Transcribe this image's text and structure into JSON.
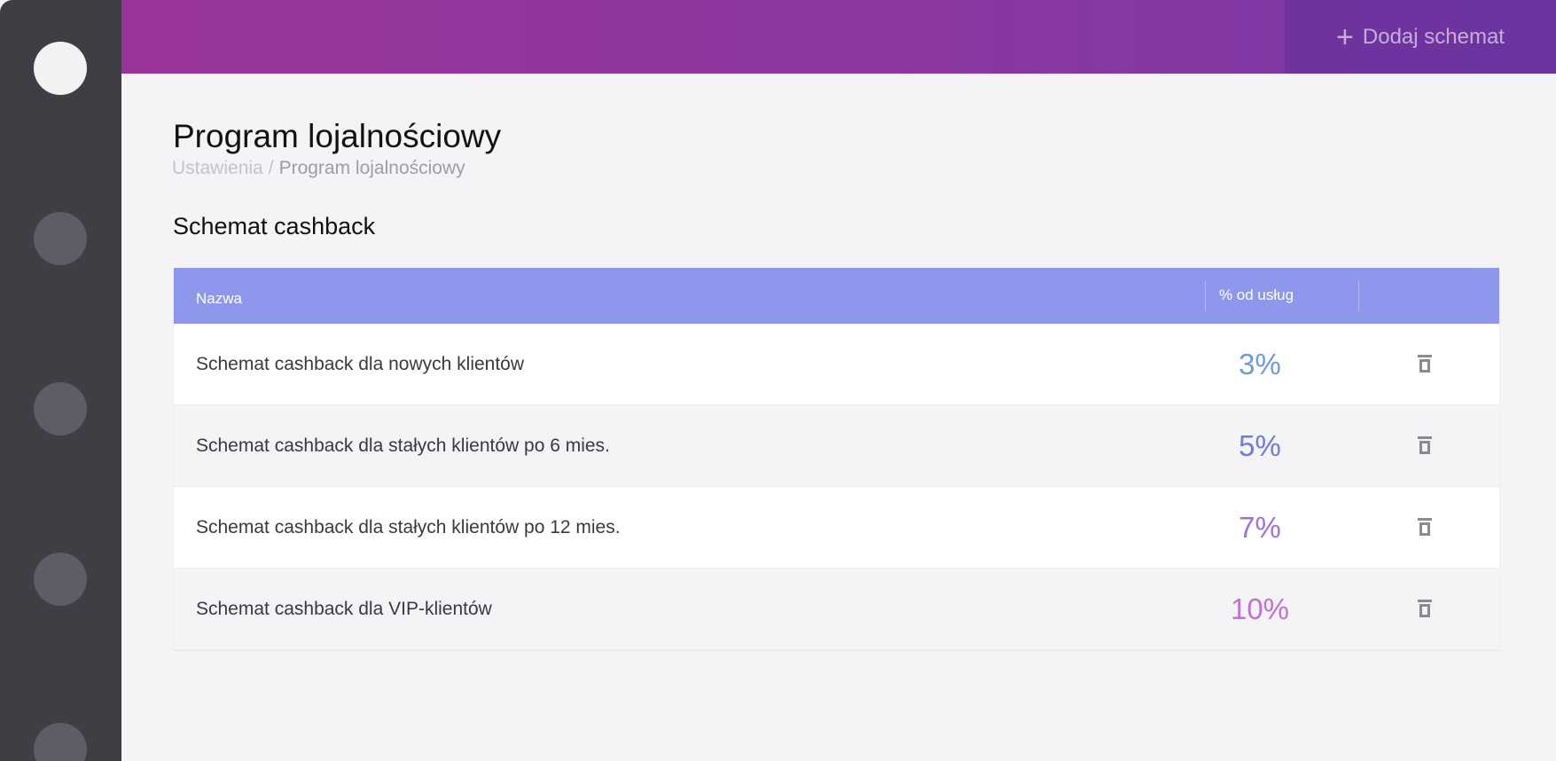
{
  "topbar": {
    "add_button_label": "Dodaj schemat"
  },
  "page": {
    "title": "Program lojalnościowy",
    "breadcrumb": {
      "parent": "Ustawienia",
      "separator": "/",
      "current": "Program lojalnościowy"
    }
  },
  "section": {
    "title": "Schemat cashback"
  },
  "table": {
    "headers": {
      "name": "Nazwa",
      "percent": "% od usług"
    },
    "rows": [
      {
        "name": "Schemat cashback dla nowych klientów",
        "percent": "3%",
        "color": "#6a9ae0"
      },
      {
        "name": "Schemat cashback dla stałych klientów po 6 mies.",
        "percent": "5%",
        "color": "#6f7bdc"
      },
      {
        "name": "Schemat cashback dla stałych klientów  po 12 mies.",
        "percent": "7%",
        "color": "#a46fda"
      },
      {
        "name": "Schemat cashback dla VIP-klientów",
        "percent": "10%",
        "color": "#c270d6"
      }
    ]
  },
  "colors": {
    "sidebar": "#3f3e44",
    "header_gradient_start": "#9a3599",
    "header_gradient_end": "#7b3aa6",
    "table_header": "#8e97ec"
  },
  "icons": {
    "add": "plus-icon",
    "delete": "trash-icon"
  }
}
